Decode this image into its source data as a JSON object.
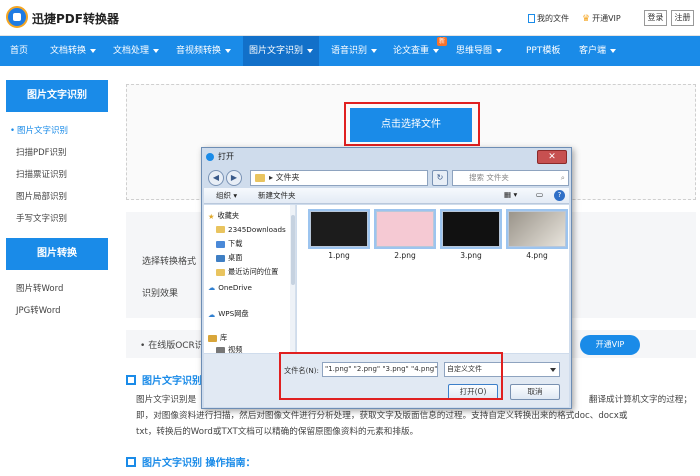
{
  "header": {
    "app_title": "迅捷PDF转换器",
    "my_files": "我的文件",
    "vip": "开通VIP",
    "login": "登录",
    "register": "注册"
  },
  "nav": {
    "items": [
      "首页",
      "文档转换",
      "文档处理",
      "音视频转换",
      "图片文字识别",
      "语音识别",
      "论文查重",
      "思维导图",
      "PPT模板",
      "客户端"
    ],
    "new_badge": "新"
  },
  "sidebar": {
    "group1_title": "图片文字识别",
    "group1_items": [
      "图片文字识别",
      "扫描PDF识别",
      "扫描票证识别",
      "图片局部识别",
      "手写文字识别"
    ],
    "group2_title": "图片转换",
    "group2_items": [
      "图片转Word",
      "JPG转Word"
    ]
  },
  "main": {
    "upload_button": "点击选择文件",
    "format_label": "选择转换格式",
    "result_label": "识别效果",
    "ocr_bar_text": "在线版OCR识",
    "vip_button": "开通VIP",
    "section1_title": "图片文字识别",
    "para_line1": "图片文字识别是",
    "para_line1_tail": "翻译成计算机文字的过程；",
    "para_line2": "即，对图像资料进行扫描，然后对图像文件进行分析处理，获取文字及版面信息的过程。支持自定义转换出来的格式doc、docx或",
    "para_line3": "txt，转换后的Word或TXT文档可以精确的保留原图像资料的元素和排版。",
    "section2_title": "图片文字识别 操作指南："
  },
  "dialog": {
    "title": "打开",
    "address": "文件夹",
    "search_placeholder": "搜索 文件夹",
    "organize": "组织",
    "new_folder": "新建文件夹",
    "tree": [
      "收藏夹",
      "2345Downloads",
      "下载",
      "桌面",
      "最近访问的位置",
      "OneDrive",
      "WPS网盘",
      "库",
      "视频"
    ],
    "files": [
      "1.png",
      "2.png",
      "3.png",
      "4.png"
    ],
    "filename_label": "文件名(N):",
    "filename_value": "\"1.png\" \"2.png\" \"3.png\" \"4.png\"",
    "filetype": "自定义文件",
    "open_button": "打开(O)",
    "cancel_button": "取消"
  },
  "colors": {
    "brand_blue": "#1a8be8",
    "highlight_red": "#e02020"
  }
}
